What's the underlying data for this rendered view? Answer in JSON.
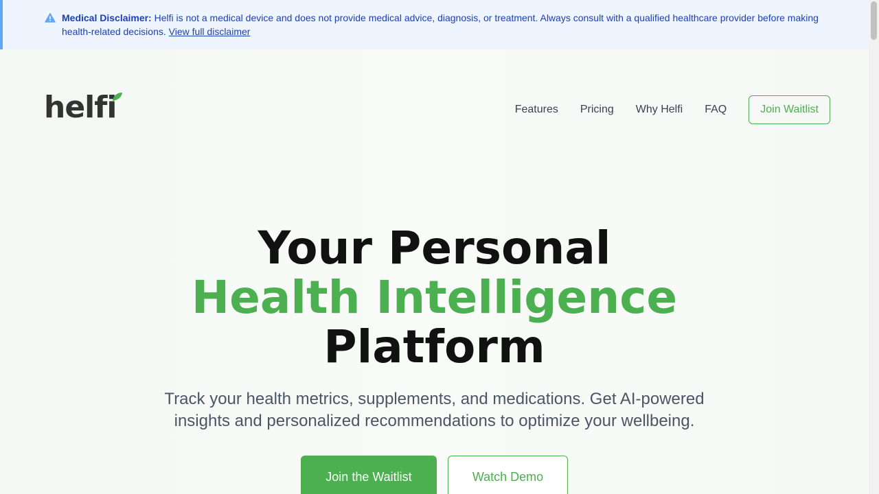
{
  "disclaimer": {
    "icon": "warning-triangle-icon",
    "title": "Medical Disclaimer:",
    "body": " Helfi is not a medical device and does not provide medical advice, diagnosis, or treatment. Always consult with a qualified healthcare provider before making health-related decisions. ",
    "link_label": "View full disclaimer",
    "colors": {
      "background": "#eef5ff",
      "accent": "#60a5fa",
      "text": "#1e40af"
    }
  },
  "brand": {
    "logo_text": "helfi",
    "logo_icon": "leaf-icon",
    "accent_color": "#4caf50"
  },
  "nav": {
    "items": [
      "Features",
      "Pricing",
      "Why Helfi",
      "FAQ"
    ],
    "cta_label": "Join Waitlist"
  },
  "hero": {
    "headline_line1": "Your Personal",
    "headline_line2": "Health Intelligence",
    "headline_line3": "Platform",
    "subhead": "Track your health metrics, supplements, and medications. Get AI-powered insights and personalized recommendations to optimize your wellbeing.",
    "primary_cta": "Join the Waitlist",
    "secondary_cta": "Watch Demo"
  }
}
